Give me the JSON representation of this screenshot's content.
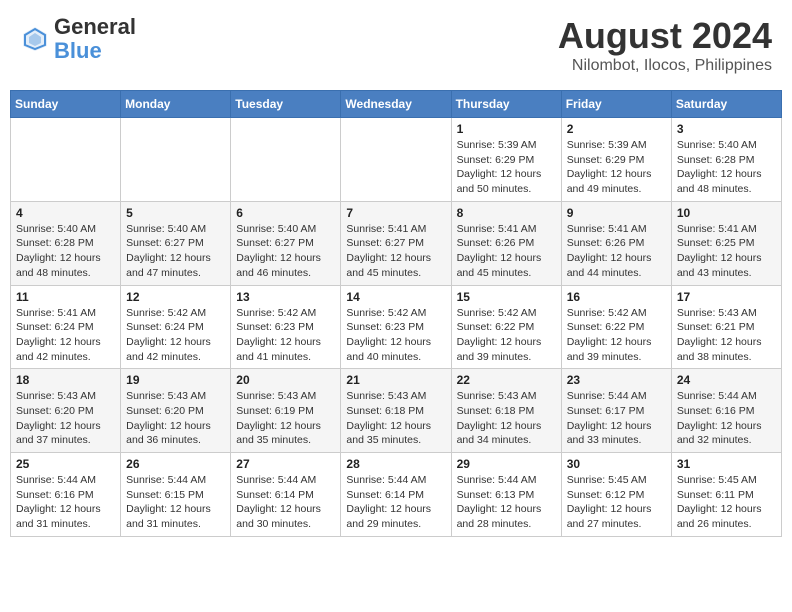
{
  "header": {
    "logo_line1": "General",
    "logo_line2": "Blue",
    "title": "August 2024",
    "subtitle": "Nilombot, Ilocos, Philippines"
  },
  "calendar": {
    "days_of_week": [
      "Sunday",
      "Monday",
      "Tuesday",
      "Wednesday",
      "Thursday",
      "Friday",
      "Saturday"
    ],
    "weeks": [
      [
        {
          "day": "",
          "info": ""
        },
        {
          "day": "",
          "info": ""
        },
        {
          "day": "",
          "info": ""
        },
        {
          "day": "",
          "info": ""
        },
        {
          "day": "1",
          "info": "Sunrise: 5:39 AM\nSunset: 6:29 PM\nDaylight: 12 hours\nand 50 minutes."
        },
        {
          "day": "2",
          "info": "Sunrise: 5:39 AM\nSunset: 6:29 PM\nDaylight: 12 hours\nand 49 minutes."
        },
        {
          "day": "3",
          "info": "Sunrise: 5:40 AM\nSunset: 6:28 PM\nDaylight: 12 hours\nand 48 minutes."
        }
      ],
      [
        {
          "day": "4",
          "info": "Sunrise: 5:40 AM\nSunset: 6:28 PM\nDaylight: 12 hours\nand 48 minutes."
        },
        {
          "day": "5",
          "info": "Sunrise: 5:40 AM\nSunset: 6:27 PM\nDaylight: 12 hours\nand 47 minutes."
        },
        {
          "day": "6",
          "info": "Sunrise: 5:40 AM\nSunset: 6:27 PM\nDaylight: 12 hours\nand 46 minutes."
        },
        {
          "day": "7",
          "info": "Sunrise: 5:41 AM\nSunset: 6:27 PM\nDaylight: 12 hours\nand 45 minutes."
        },
        {
          "day": "8",
          "info": "Sunrise: 5:41 AM\nSunset: 6:26 PM\nDaylight: 12 hours\nand 45 minutes."
        },
        {
          "day": "9",
          "info": "Sunrise: 5:41 AM\nSunset: 6:26 PM\nDaylight: 12 hours\nand 44 minutes."
        },
        {
          "day": "10",
          "info": "Sunrise: 5:41 AM\nSunset: 6:25 PM\nDaylight: 12 hours\nand 43 minutes."
        }
      ],
      [
        {
          "day": "11",
          "info": "Sunrise: 5:41 AM\nSunset: 6:24 PM\nDaylight: 12 hours\nand 42 minutes."
        },
        {
          "day": "12",
          "info": "Sunrise: 5:42 AM\nSunset: 6:24 PM\nDaylight: 12 hours\nand 42 minutes."
        },
        {
          "day": "13",
          "info": "Sunrise: 5:42 AM\nSunset: 6:23 PM\nDaylight: 12 hours\nand 41 minutes."
        },
        {
          "day": "14",
          "info": "Sunrise: 5:42 AM\nSunset: 6:23 PM\nDaylight: 12 hours\nand 40 minutes."
        },
        {
          "day": "15",
          "info": "Sunrise: 5:42 AM\nSunset: 6:22 PM\nDaylight: 12 hours\nand 39 minutes."
        },
        {
          "day": "16",
          "info": "Sunrise: 5:42 AM\nSunset: 6:22 PM\nDaylight: 12 hours\nand 39 minutes."
        },
        {
          "day": "17",
          "info": "Sunrise: 5:43 AM\nSunset: 6:21 PM\nDaylight: 12 hours\nand 38 minutes."
        }
      ],
      [
        {
          "day": "18",
          "info": "Sunrise: 5:43 AM\nSunset: 6:20 PM\nDaylight: 12 hours\nand 37 minutes."
        },
        {
          "day": "19",
          "info": "Sunrise: 5:43 AM\nSunset: 6:20 PM\nDaylight: 12 hours\nand 36 minutes."
        },
        {
          "day": "20",
          "info": "Sunrise: 5:43 AM\nSunset: 6:19 PM\nDaylight: 12 hours\nand 35 minutes."
        },
        {
          "day": "21",
          "info": "Sunrise: 5:43 AM\nSunset: 6:18 PM\nDaylight: 12 hours\nand 35 minutes."
        },
        {
          "day": "22",
          "info": "Sunrise: 5:43 AM\nSunset: 6:18 PM\nDaylight: 12 hours\nand 34 minutes."
        },
        {
          "day": "23",
          "info": "Sunrise: 5:44 AM\nSunset: 6:17 PM\nDaylight: 12 hours\nand 33 minutes."
        },
        {
          "day": "24",
          "info": "Sunrise: 5:44 AM\nSunset: 6:16 PM\nDaylight: 12 hours\nand 32 minutes."
        }
      ],
      [
        {
          "day": "25",
          "info": "Sunrise: 5:44 AM\nSunset: 6:16 PM\nDaylight: 12 hours\nand 31 minutes."
        },
        {
          "day": "26",
          "info": "Sunrise: 5:44 AM\nSunset: 6:15 PM\nDaylight: 12 hours\nand 31 minutes."
        },
        {
          "day": "27",
          "info": "Sunrise: 5:44 AM\nSunset: 6:14 PM\nDaylight: 12 hours\nand 30 minutes."
        },
        {
          "day": "28",
          "info": "Sunrise: 5:44 AM\nSunset: 6:14 PM\nDaylight: 12 hours\nand 29 minutes."
        },
        {
          "day": "29",
          "info": "Sunrise: 5:44 AM\nSunset: 6:13 PM\nDaylight: 12 hours\nand 28 minutes."
        },
        {
          "day": "30",
          "info": "Sunrise: 5:45 AM\nSunset: 6:12 PM\nDaylight: 12 hours\nand 27 minutes."
        },
        {
          "day": "31",
          "info": "Sunrise: 5:45 AM\nSunset: 6:11 PM\nDaylight: 12 hours\nand 26 minutes."
        }
      ]
    ]
  }
}
